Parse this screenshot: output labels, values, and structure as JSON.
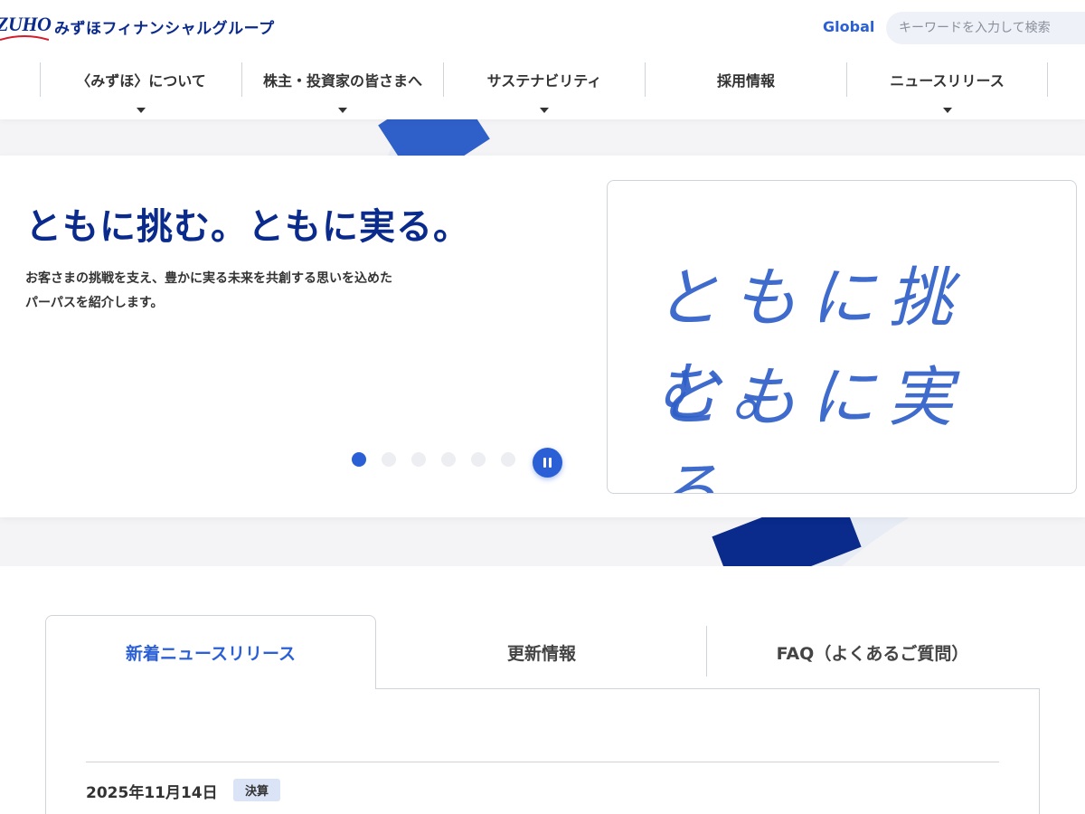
{
  "brand": {
    "logo_mark": "ZUHO",
    "logo_text": "みずほフィナンシャルグループ",
    "accent": "#2a5fd6",
    "navy": "#0a2a8c"
  },
  "header": {
    "global_label": "Global",
    "search_placeholder": "キーワードを入力して検索"
  },
  "nav": {
    "items": [
      {
        "label": "〈みずほ〉について",
        "has_menu": true
      },
      {
        "label": "株主・投資家の皆さまへ",
        "has_menu": true
      },
      {
        "label": "サステナビリティ",
        "has_menu": true
      },
      {
        "label": "採用情報",
        "has_menu": false
      },
      {
        "label": "ニュースリリース",
        "has_menu": true
      }
    ]
  },
  "hero": {
    "title": "ともに挑む。ともに実る。",
    "desc_line1": "お客さまの挑戦を支え、豊かに実る未来を共創する思いを込めた",
    "desc_line2": "パーパスを紹介します。",
    "image_line1": "ともに挑む。",
    "image_line2": "ともに実る。",
    "slide_count": 6,
    "active_slide": 1
  },
  "tabs": {
    "items": [
      {
        "label": "新着ニュースリリース",
        "active": true
      },
      {
        "label": "更新情報",
        "active": false
      },
      {
        "label": "FAQ（よくあるご質問）",
        "active": false
      }
    ]
  },
  "news": {
    "first_date": "2025年11月14日",
    "first_tag": "決算"
  }
}
